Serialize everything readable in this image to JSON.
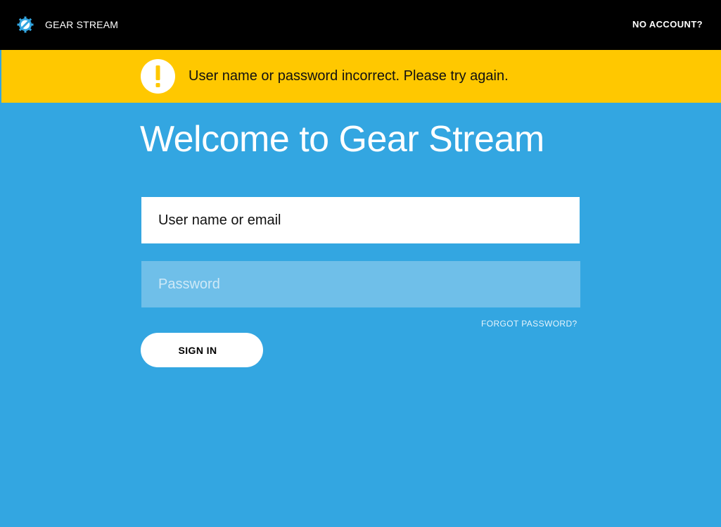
{
  "header": {
    "brand_label": "GEAR STREAM",
    "brand_icon": "gear-icon",
    "no_account_link": "NO ACCOUNT?"
  },
  "alert": {
    "icon": "exclamation-icon",
    "message": "User name or password incorrect. Please try again.",
    "color": "#ffc800"
  },
  "main": {
    "title": "Welcome to Gear Stream"
  },
  "form": {
    "username_placeholder": "User name or email",
    "username_value": "",
    "password_placeholder": "Password",
    "password_value": "",
    "forgot_link": "FORGOT PASSWORD?",
    "signin_label": "SIGN IN"
  },
  "colors": {
    "background": "#33a6e1",
    "header": "#000000",
    "alert": "#ffc800",
    "password_field": "#6fbfe9"
  }
}
